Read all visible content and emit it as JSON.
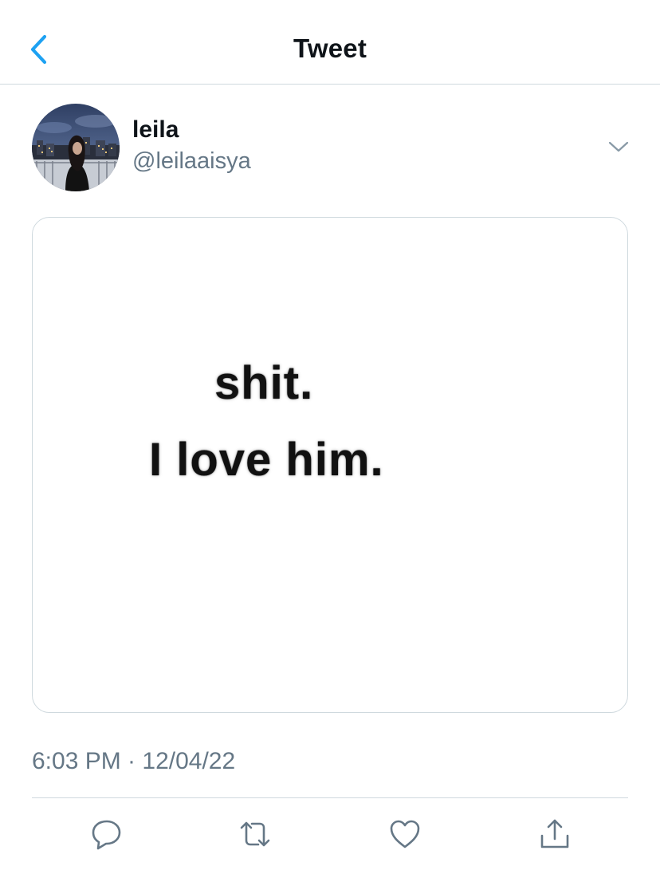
{
  "header": {
    "title": "Tweet",
    "back_icon": "chevron-left-icon"
  },
  "colors": {
    "accent": "#1da1f2",
    "text_primary": "#0f1419",
    "text_secondary": "#657786",
    "border": "#cfd9de",
    "icon": "#657786"
  },
  "author": {
    "display_name": "leila",
    "handle": "@leilaaisya",
    "menu_icon": "chevron-down-icon"
  },
  "media": {
    "lines": [
      "shit.",
      "I love him."
    ]
  },
  "tweet": {
    "timestamp": "6:03 PM · 12/04/22"
  },
  "actions": [
    {
      "name": "reply",
      "icon": "reply-icon"
    },
    {
      "name": "retweet",
      "icon": "retweet-icon"
    },
    {
      "name": "like",
      "icon": "heart-icon"
    },
    {
      "name": "share",
      "icon": "share-icon"
    }
  ]
}
